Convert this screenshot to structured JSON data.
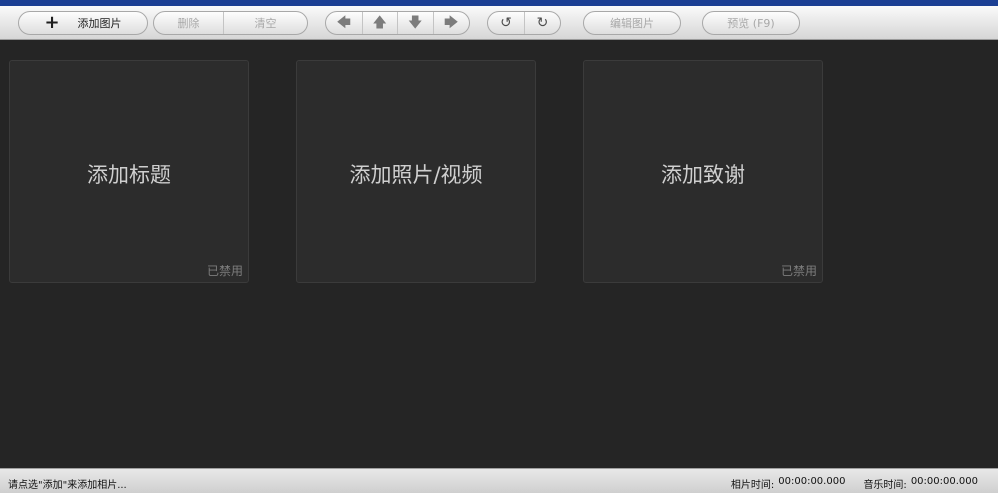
{
  "toolbar": {
    "add_image": "添加图片",
    "delete": "删除",
    "clear": "清空",
    "edit_image": "编辑图片",
    "preview": "预览 (F9)"
  },
  "cards": [
    {
      "title": "添加标题",
      "status": "已禁用"
    },
    {
      "title": "添加照片/视频",
      "status": ""
    },
    {
      "title": "添加致谢",
      "status": "已禁用"
    }
  ],
  "statusbar": {
    "hint": "请点选\"添加\"来添加相片...",
    "photo_time_label": "相片时间:",
    "photo_time_value": "00:00:00.000",
    "music_time_label": "音乐时间:",
    "music_time_value": "00:00:00.000"
  },
  "colors": {
    "title_bar": "#1b3f93",
    "workspace_bg": "#252525",
    "card_bg": "#2c2c2c"
  }
}
